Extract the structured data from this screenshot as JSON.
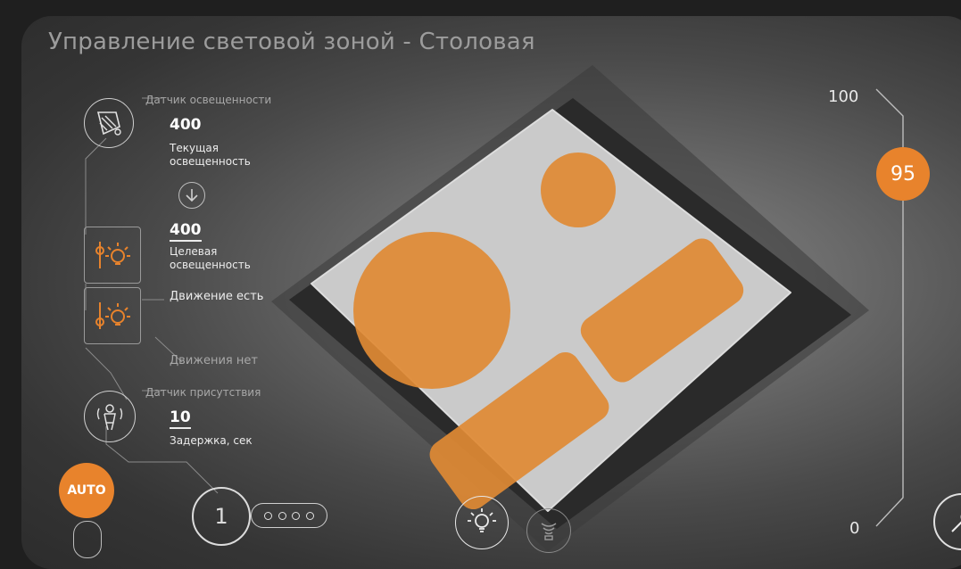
{
  "title": "Управление световой зоной - Столовая",
  "light_sensor": {
    "label": "Датчик освещенности",
    "current_value": "400",
    "current_caption": "Текущая освещенность",
    "target_value": "400",
    "target_caption": "Целевая освещенность",
    "icon": "light-sensor-icon"
  },
  "motion": {
    "present_label": "Движение есть",
    "absent_label": "Движения нет"
  },
  "presence_sensor": {
    "label": "Датчик присутствия",
    "delay_value": "10",
    "delay_caption": "Задержка, сек"
  },
  "auto_button": {
    "label": "AUTO"
  },
  "pager": {
    "current": "1",
    "total_dots": 4
  },
  "slider": {
    "max_label": "100",
    "min_label": "0",
    "value": "95",
    "fraction": 0.95
  },
  "colors": {
    "accent": "#e8832c",
    "panel": "#cfcfcf"
  }
}
